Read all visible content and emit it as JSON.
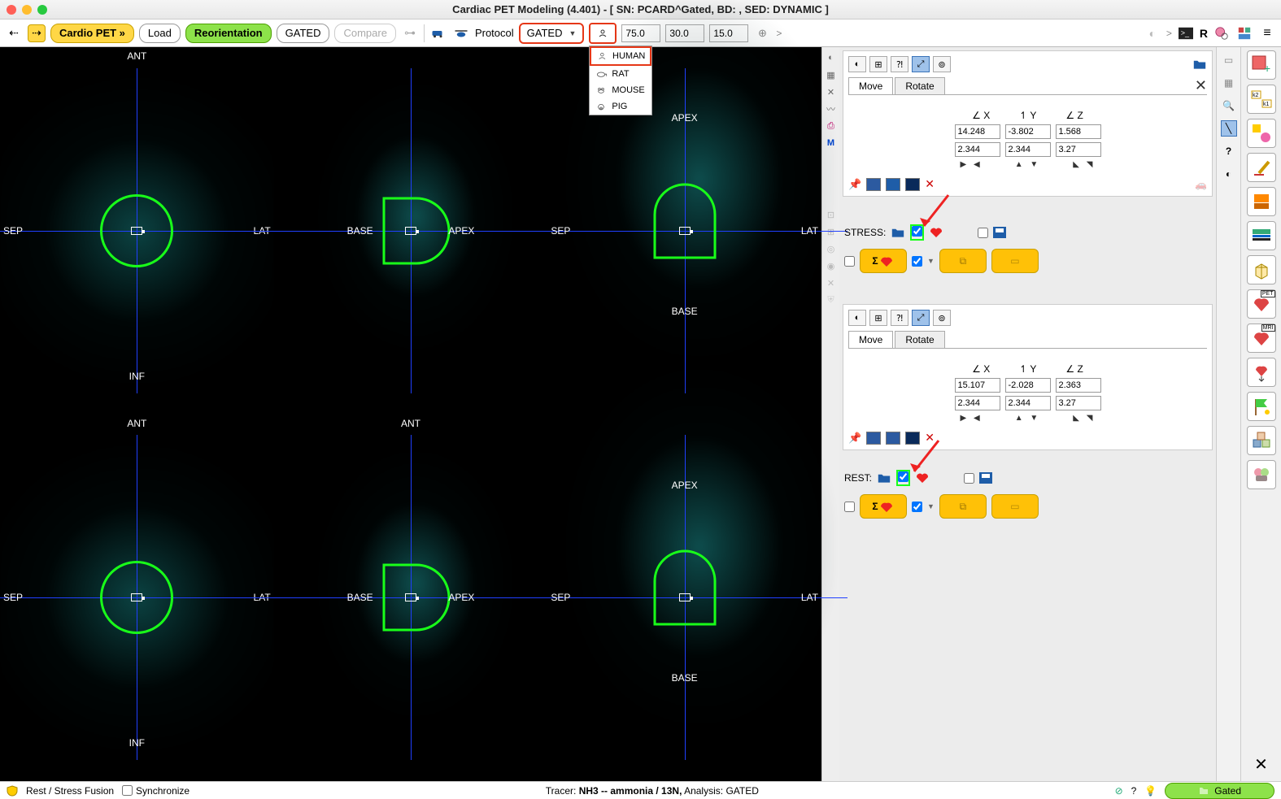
{
  "window": {
    "title": "Cardiac PET Modeling (4.401) - [ SN: PCARD^Gated, BD: , SED: DYNAMIC ]"
  },
  "toolbar": {
    "cardio_label": "Cardio PET »",
    "load_label": "Load",
    "reorientation_label": "Reorientation",
    "gated_label": "GATED",
    "compare_label": "Compare",
    "protocol_label": "Protocol",
    "gated_select": "GATED",
    "num1": "75.0",
    "num2": "30.0",
    "num3": "15.0",
    "r_label": "R",
    "chev": ">"
  },
  "species": [
    {
      "label": "HUMAN",
      "highlighted": true
    },
    {
      "label": "RAT"
    },
    {
      "label": "MOUSE"
    },
    {
      "label": "PIG"
    }
  ],
  "views": {
    "row1": {
      "cell1": {
        "top": "ANT",
        "right": "LAT",
        "bottom": "INF",
        "left": "SEP"
      },
      "cell2": {
        "left": "BASE",
        "right": "APEX"
      },
      "cell3": {
        "top": "APEX",
        "right": "LAT",
        "bottom": "BASE",
        "left": "SEP"
      }
    },
    "row2": {
      "cell1": {
        "top": "ANT",
        "right": "LAT",
        "bottom": "INF",
        "left": "SEP"
      },
      "cell2": {
        "top": "ANT",
        "left": "BASE",
        "right": "APEX"
      },
      "cell3": {
        "top": "APEX",
        "right": "LAT",
        "bottom": "BASE",
        "left": "SEP"
      }
    }
  },
  "panel_top": {
    "tab_move": "Move",
    "tab_rotate": "Rotate",
    "x_label": "X",
    "y_label": "Y",
    "z_label": "Z",
    "x": "14.248",
    "y": "-3.802",
    "z": "1.568",
    "x2": "2.344",
    "y2": "2.344",
    "z2": "3.27",
    "stress_label": "STRESS:"
  },
  "panel_bottom": {
    "tab_move": "Move",
    "tab_rotate": "Rotate",
    "x_label": "X",
    "y_label": "Y",
    "z_label": "Z",
    "x": "15.107",
    "y": "-2.028",
    "z": "2.363",
    "x2": "2.344",
    "y2": "2.344",
    "z2": "3.27",
    "rest_label": "REST:"
  },
  "status": {
    "fusion_label": "Rest / Stress Fusion",
    "sync_label": "Synchronize",
    "tracer_prefix": "Tracer: ",
    "tracer_value": "NH3 -- ammonia / 13N,",
    "analysis_prefix": "  Analysis: ",
    "analysis_value": "GATED",
    "gated_btn": "Gated"
  }
}
